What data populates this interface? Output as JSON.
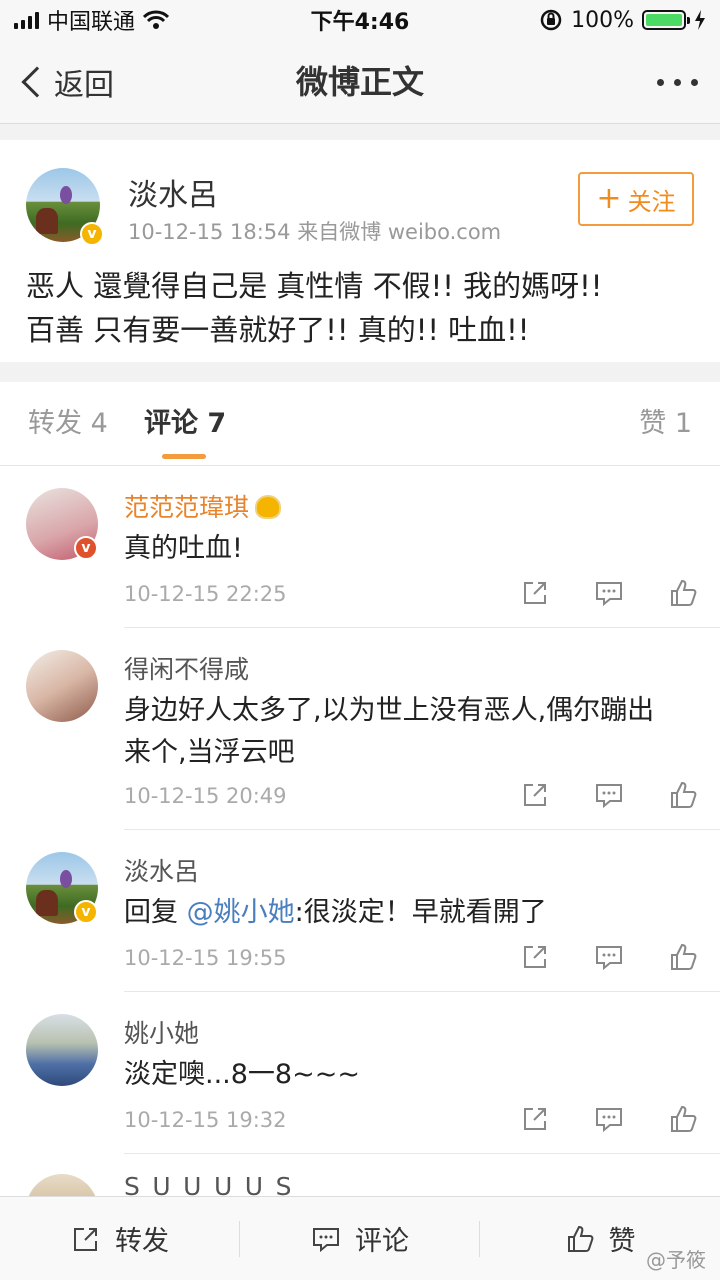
{
  "status_bar": {
    "carrier": "中国联通",
    "time": "下午4:46",
    "battery_percent": "100%",
    "battery_level": 1.0
  },
  "nav": {
    "back_label": "返回",
    "title": "微博正文"
  },
  "post": {
    "author": "淡水呂",
    "meta": "10-12-15 18:54  来自微博 weibo.com",
    "follow_label": "关注",
    "content_line1": "恶人 還覺得自己是 真性情   不假!! 我的媽呀!!",
    "content_line2": "百善  只有要一善就好了!! 真的!! 吐血!!"
  },
  "tabs": {
    "repost": "转发 4",
    "comment": "评论 7",
    "like": "赞 1"
  },
  "comments": [
    {
      "name": "范范范瑋琪",
      "text": "真的吐血!",
      "time": "10-12-15 22:25"
    },
    {
      "name": "得闲不得咸",
      "text_line1": "身边好人太多了,以为世上没有恶人,偶尔蹦出",
      "text_line2": "来个,当浮云吧",
      "time": "10-12-15 20:49"
    },
    {
      "name": "淡水呂",
      "prefix": "回复 ",
      "mention": "@姚小她",
      "text": ":很淡定！早就看開了",
      "time": "10-12-15 19:55"
    },
    {
      "name": "姚小她",
      "text": "淡定噢...8一8~~~",
      "time": "10-12-15 19:32"
    },
    {
      "name": "S_U_U_U_U_S"
    }
  ],
  "bottom_bar": {
    "repost": "转发",
    "comment": "评论",
    "like": "赞"
  },
  "watermark": "@予筱",
  "colors": {
    "accent": "#f29c3c",
    "vip_name": "#e8842c",
    "mention": "#4a7fbf",
    "battery": "#4cd964"
  }
}
